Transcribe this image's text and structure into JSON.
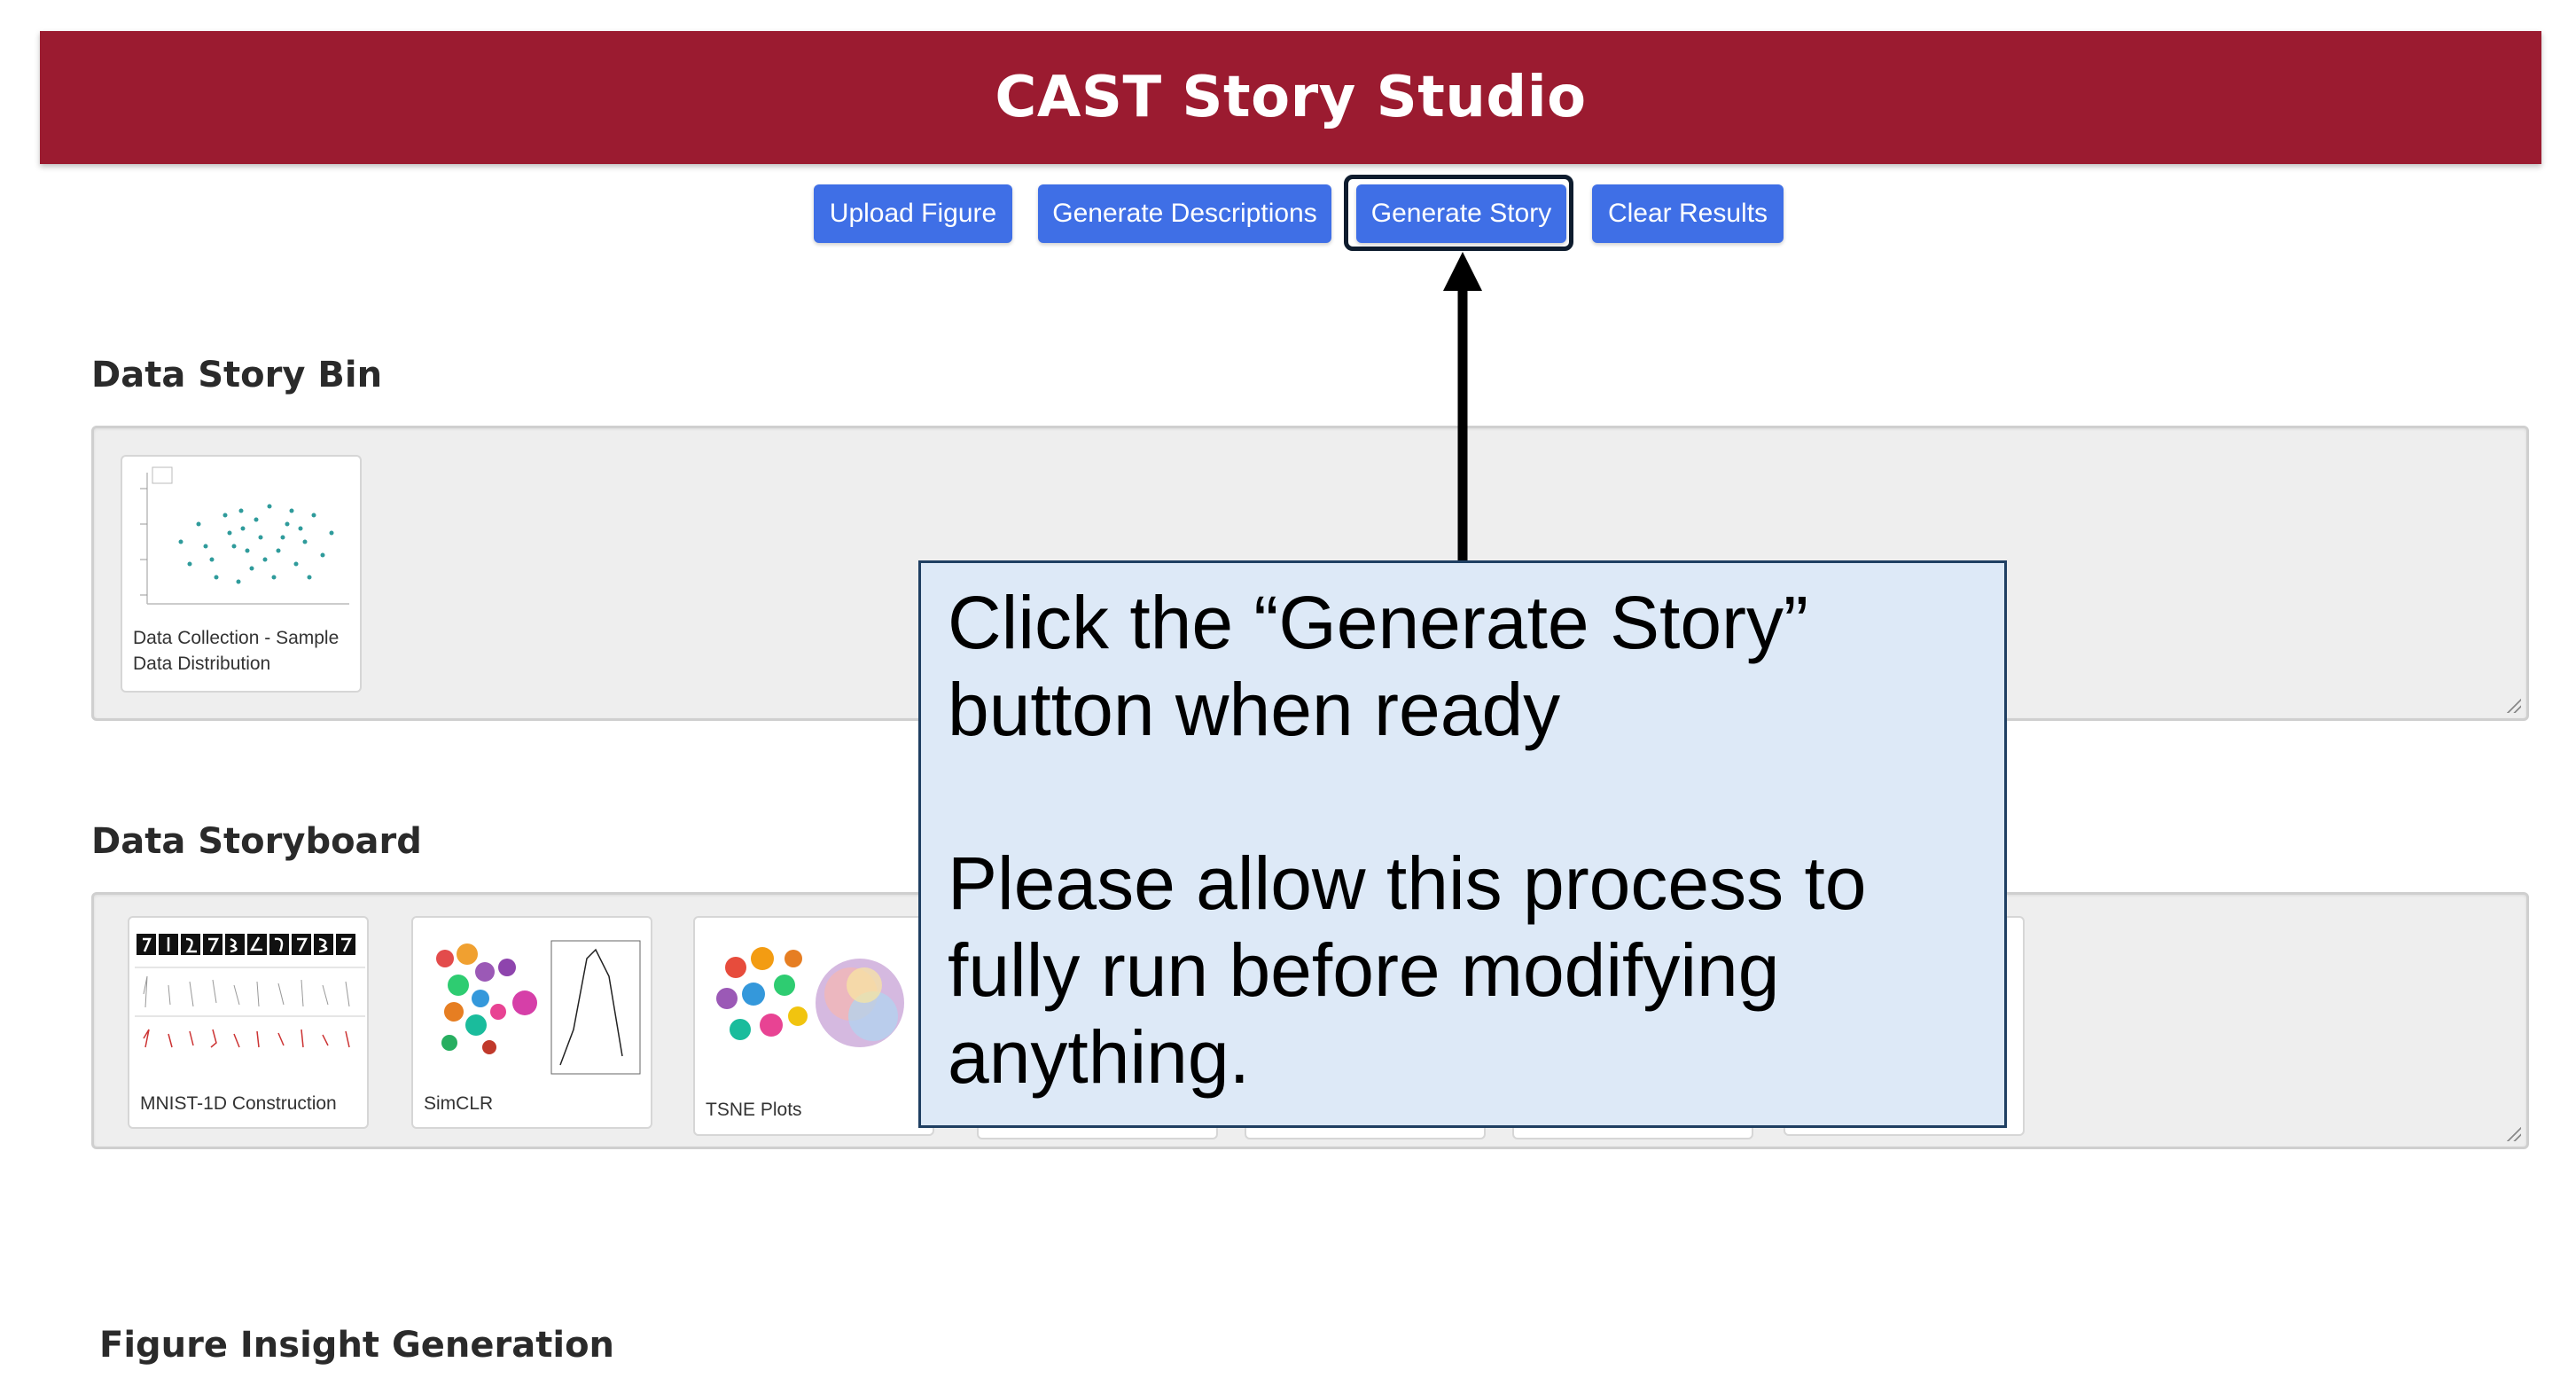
{
  "app": {
    "title": "CAST Story Studio"
  },
  "toolbar": {
    "upload_label": "Upload Figure",
    "descriptions_label": "Generate Descriptions",
    "story_label": "Generate Story",
    "clear_label": "Clear Results"
  },
  "data_story_bin": {
    "title": "Data Story Bin",
    "cards": [
      {
        "caption": "Data Collection - Sample Data Distribution"
      }
    ]
  },
  "data_storyboard": {
    "title": "Data Storyboard",
    "cards": [
      {
        "caption": "MNIST-1D Construction"
      },
      {
        "caption": "SimCLR"
      },
      {
        "caption": "TSNE Plots"
      }
    ]
  },
  "figure_insight": {
    "title": "Figure Insight Generation"
  },
  "callout": {
    "line1": "Click the “Generate Story” button when ready",
    "line2": "Please allow this process to fully run before modifying anything."
  },
  "colors": {
    "header_bg": "#9b1b30",
    "button_bg": "#3f6fe6",
    "callout_bg": "#dde9f7",
    "callout_border": "#1f3f62"
  }
}
